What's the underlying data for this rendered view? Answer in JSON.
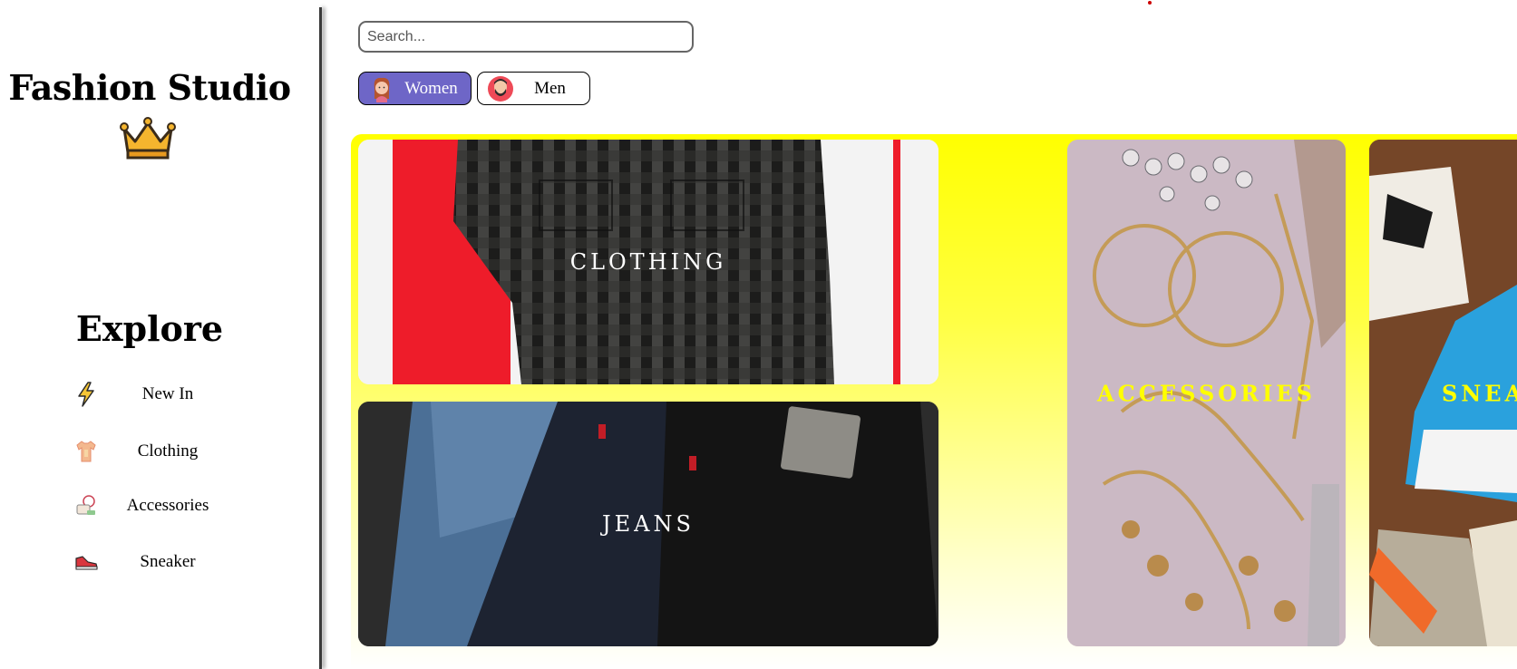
{
  "sidebar": {
    "brand": "Fashion Studio",
    "explore_title": "Explore",
    "items": [
      {
        "label": "New In",
        "icon": "lightning-icon"
      },
      {
        "label": "Clothing",
        "icon": "tshirt-icon"
      },
      {
        "label": "Accessories",
        "icon": "accessories-icon"
      },
      {
        "label": "Sneaker",
        "icon": "sneaker-icon"
      }
    ]
  },
  "search": {
    "placeholder": "Search..."
  },
  "gender": {
    "women_label": "Women",
    "men_label": "Men",
    "selected": "Women"
  },
  "colors": {
    "accent": "#6e66c7",
    "content_bg": "#ffff00",
    "accessories_label": "#ffff00"
  },
  "cards": {
    "clothing": "CLOTHING",
    "jeans": "JEANS",
    "accessories": "ACCESSORIES",
    "sneakers": "SNEA"
  }
}
